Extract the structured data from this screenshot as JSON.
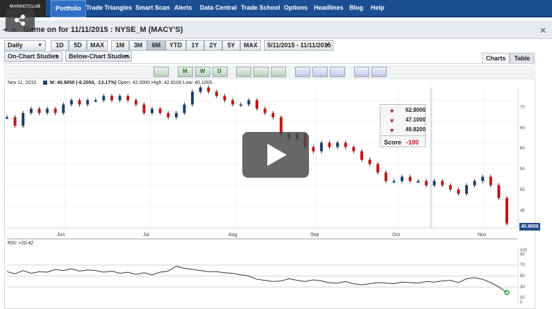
{
  "nav": {
    "logo": "MARKETCLUB",
    "items": [
      "Portfolio",
      "Trade Triangles",
      "Smart Scan",
      "Alerts",
      "Data Central",
      "Trade School",
      "Options",
      "Headlines",
      "Blog",
      "Help"
    ],
    "active": "Portfolio"
  },
  "window": {
    "title": "Game on for 11/11/2015 : NYSE_M (MACY'S)"
  },
  "toolbar": {
    "interval": "Daily",
    "ranges": [
      "1D",
      "5D",
      "MAX",
      "1M",
      "3M",
      "6M",
      "YTD",
      "1Y",
      "2Y",
      "5Y",
      "MAX"
    ],
    "active_range": "6M",
    "date_range": "5/11/2015 - 11/11/2015",
    "on_chart": "On-Chart Studies",
    "below_chart": "Below-Chart Studies",
    "tabs": [
      "Charts",
      "Table"
    ],
    "active_tab": "Charts",
    "tool_labels": [
      "M",
      "W",
      "D"
    ]
  },
  "price_info": {
    "date": "Nov 11, 2015",
    "symbol_line": "M: 40.9050 (-6.2050, -13.17%)",
    "open": "Open: 42.0000",
    "high": "High: 42.8100",
    "low": "Low: 40.1000"
  },
  "score": {
    "rows": [
      "62.8000",
      "47.1000",
      "49.8200"
    ],
    "label": "Score",
    "value": "-100"
  },
  "last_price": "40.9050",
  "rsi_label": "RSI: +20.42",
  "months": [
    "Jun",
    "Jul",
    "Aug",
    "Sep",
    "Oct",
    "Nov"
  ],
  "price_axis": [
    "70",
    "65",
    "60",
    "55",
    "50",
    "45"
  ],
  "rsi_axis": [
    "100",
    "90",
    "70",
    "50",
    "30",
    "10",
    "0"
  ],
  "colors": {
    "nav": "#1a4f93",
    "bull": "#1b3f6e",
    "bear": "#c0161a"
  },
  "chart_data": {
    "type": "line",
    "series": [
      {
        "name": "M",
        "values": [
          66,
          64,
          67,
          68,
          67,
          68,
          67,
          69,
          70,
          69,
          70,
          70,
          71,
          70,
          71,
          70,
          69,
          67,
          68,
          67,
          66,
          67,
          69,
          72,
          73,
          72,
          71,
          70,
          69,
          69,
          70,
          68,
          67,
          66,
          62,
          61,
          62,
          59,
          58,
          60,
          59,
          60,
          59,
          58,
          56,
          55,
          53,
          51,
          51,
          52,
          51,
          51,
          50,
          51,
          50,
          49,
          48,
          50,
          51,
          52,
          50,
          47,
          41
        ]
      },
      {
        "name": "RSI",
        "values": [
          58,
          54,
          60,
          55,
          58,
          57,
          62,
          60,
          63,
          59,
          61,
          60,
          57,
          59,
          55,
          57,
          53,
          56,
          52,
          57,
          59,
          68,
          64,
          62,
          60,
          58,
          58,
          56,
          55,
          52,
          50,
          44,
          42,
          40,
          41,
          45,
          42,
          40,
          43,
          41,
          38,
          37,
          40,
          36,
          34,
          36,
          38,
          37,
          36,
          39,
          38,
          37,
          40,
          39,
          41,
          42,
          38,
          45,
          47,
          44,
          38,
          30,
          20
        ]
      }
    ],
    "ylim": [
      40,
      73
    ],
    "rsi_ylim": [
      0,
      100
    ]
  }
}
